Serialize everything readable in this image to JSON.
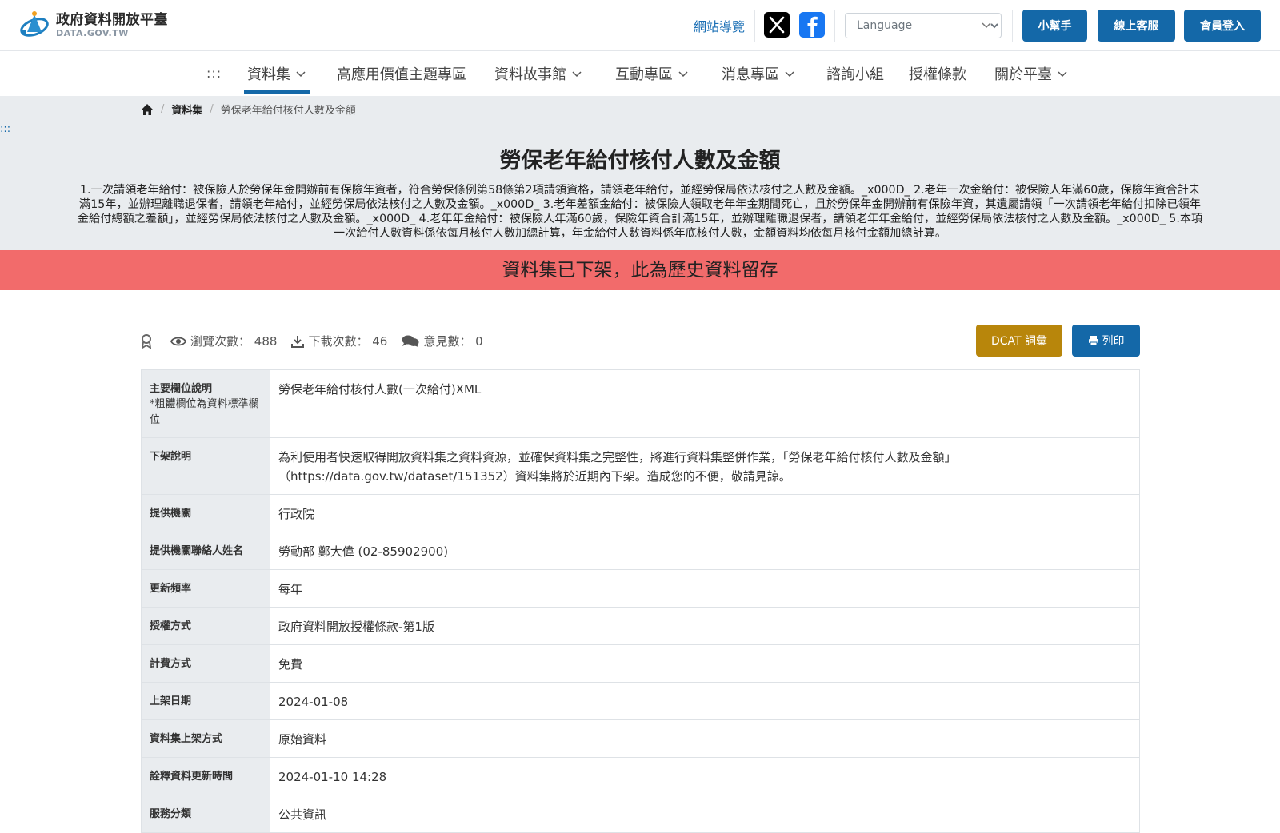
{
  "header": {
    "logo_title": "政府資料開放平臺",
    "logo_sub": "DATA.GOV.TW",
    "sitemap": "網站導覽",
    "language_placeholder": "Language",
    "buttons": {
      "helper": "小幫手",
      "service": "線上客服",
      "login": "會員登入"
    }
  },
  "nav": {
    "dots": ":::",
    "items": [
      {
        "label": "資料集"
      },
      {
        "label": "高應用價值主題專區"
      },
      {
        "label": "資料故事館"
      },
      {
        "label": "互動專區"
      },
      {
        "label": "消息專區"
      },
      {
        "label": "諮詢小組"
      },
      {
        "label": "授權條款"
      },
      {
        "label": "關於平臺"
      }
    ]
  },
  "breadcrumb": {
    "items": [
      "資料集",
      "勞保老年給付核付人數及金額"
    ]
  },
  "side_dots": ":::",
  "page": {
    "title": "勞保老年給付核付人數及金額",
    "description": "1.一次請領老年給付：被保險人於勞保年金開辦前有保險年資者，符合勞保條例第58條第2項請領資格，請領老年給付，並經勞保局依法核付之人數及金額。_x000D_ 2.老年一次金給付：被保險人年滿60歲，保險年資合計未滿15年，並辦理離職退保者，請領老年給付，並經勞保局依法核付之人數及金額。_x000D_ 3.老年差額金給付：被保險人領取老年年金期間死亡，且於勞保年金開辦前有保險年資，其遺屬請領「一次請領老年給付扣除已領年金給付總額之差額」，並經勞保局依法核付之人數及金額。_x000D_ 4.老年年金給付：被保險人年滿60歲，保險年資合計滿15年，並辦理離職退保者，請領老年年金給付，並經勞保局依法核付之人數及金額。_x000D_ 5.本項一次給付人數資料係依每月核付人數加總計算，年金給付人數資料係年底核付人數，金額資料均依每月核付金額加總計算。",
    "alert": "資料集已下架，此為歷史資料留存"
  },
  "stats": {
    "views_label": "瀏覽次數：",
    "views": "488",
    "downloads_label": "下載次數：",
    "downloads": "46",
    "comments_label": "意見數：",
    "comments": "0"
  },
  "actions": {
    "dcat": "DCAT 詞彙",
    "print": "列印"
  },
  "table": [
    {
      "key": "主要欄位說明",
      "note": "*粗體欄位為資料標準欄位",
      "value": "勞保老年給付核付人數(一次給付)XML"
    },
    {
      "key": "下架說明",
      "value": "為利使用者快速取得開放資料集之資料資源，並確保資料集之完整性，將進行資料集整併作業，「勞保老年給付核付人數及金額」（https://data.gov.tw/dataset/151352）資料集將於近期內下架。造成您的不便，敬請見諒。"
    },
    {
      "key": "提供機關",
      "value": "行政院"
    },
    {
      "key": "提供機關聯絡人姓名",
      "value": "勞動部 鄭大偉 (02-85902900)"
    },
    {
      "key": "更新頻率",
      "value": "每年"
    },
    {
      "key": "授權方式",
      "value": "政府資料開放授權條款-第1版"
    },
    {
      "key": "計費方式",
      "value": "免費"
    },
    {
      "key": "上架日期",
      "value": "2024-01-08"
    },
    {
      "key": "資料集上架方式",
      "value": "原始資料"
    },
    {
      "key": "詮釋資料更新時間",
      "value": "2024-01-10 14:28"
    },
    {
      "key": "服務分類",
      "value": "公共資訊"
    }
  ],
  "colors": {
    "primary": "#1468a8",
    "alert": "#f26b6b",
    "dcat": "#b8860b",
    "hero_bg": "#e9ecef"
  }
}
